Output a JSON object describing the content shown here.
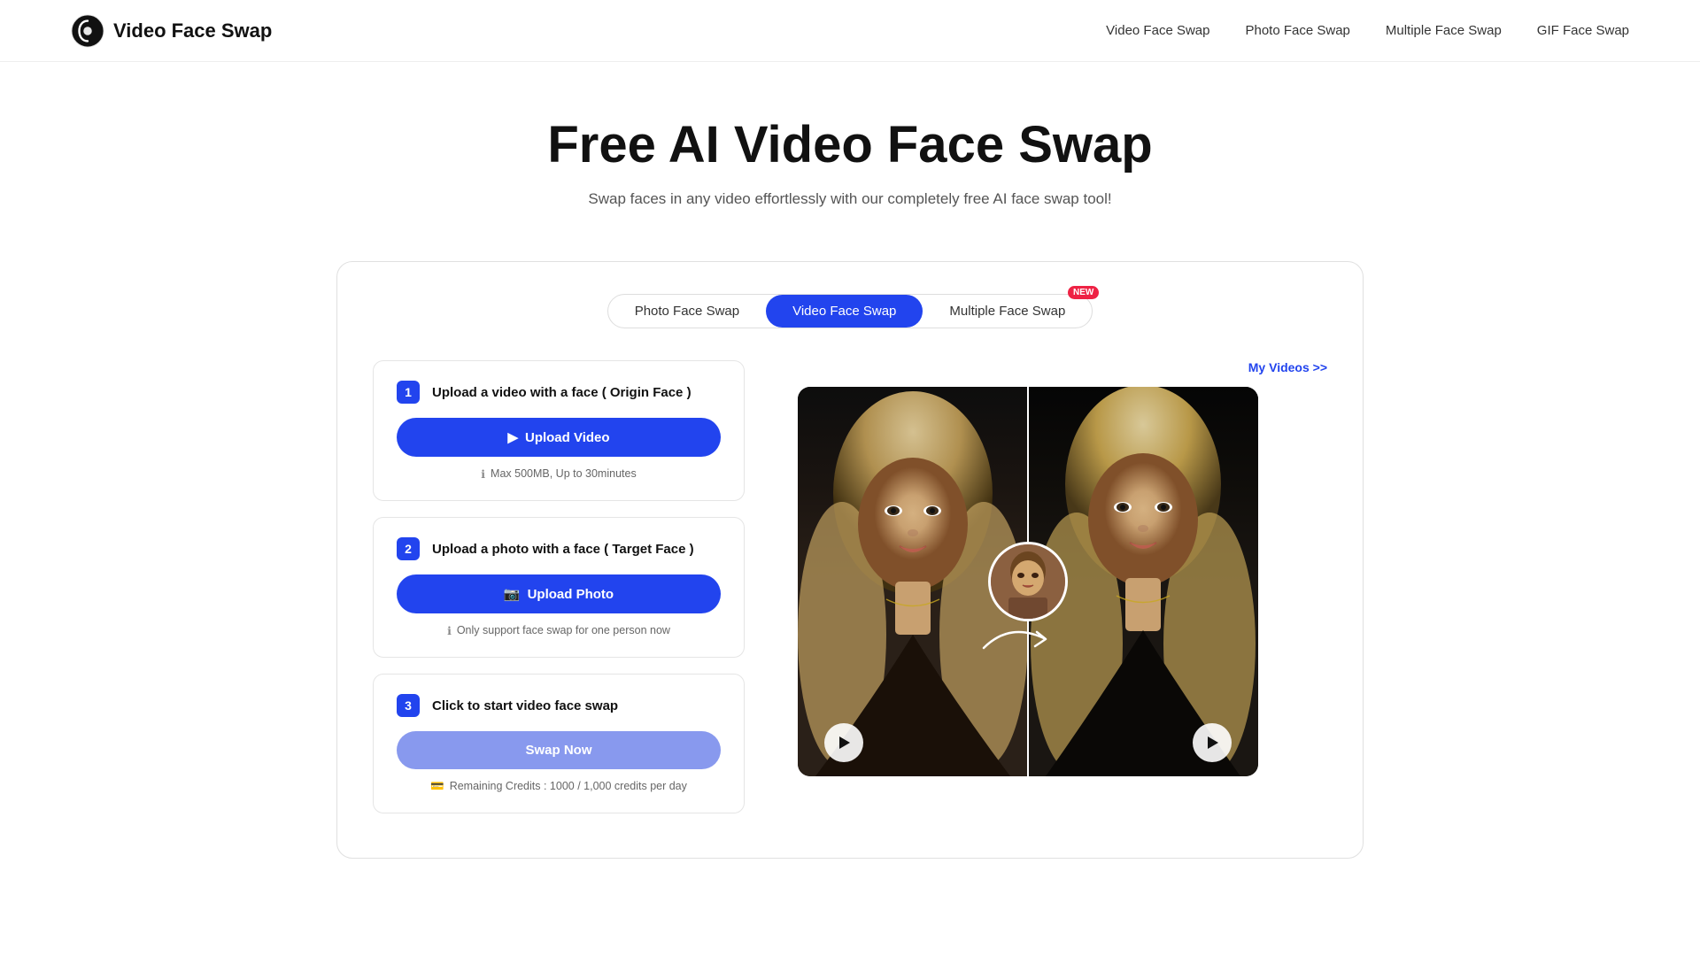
{
  "nav": {
    "logo_text": "Video Face Swap",
    "links": [
      {
        "label": "Video Face Swap",
        "id": "nav-video-face-swap"
      },
      {
        "label": "Photo Face Swap",
        "id": "nav-photo-face-swap"
      },
      {
        "label": "Multiple Face Swap",
        "id": "nav-multiple-face-swap"
      },
      {
        "label": "GIF Face Swap",
        "id": "nav-gif-face-swap"
      }
    ]
  },
  "hero": {
    "title": "Free AI Video Face Swap",
    "subtitle": "Swap faces in any video effortlessly with our completely free AI face swap tool!"
  },
  "tabs": [
    {
      "label": "Photo Face Swap",
      "active": false,
      "badge": null
    },
    {
      "label": "Video Face Swap",
      "active": true,
      "badge": null
    },
    {
      "label": "Multiple Face Swap",
      "active": false,
      "badge": "NEW"
    }
  ],
  "my_videos_link": "My Videos >>",
  "steps": [
    {
      "num": "1",
      "title": "Upload a video with a face ( Origin Face )",
      "button_label": "Upload Video",
      "note": "Max 500MB, Up to 30minutes",
      "note_type": "info"
    },
    {
      "num": "2",
      "title": "Upload a photo with a face ( Target Face )",
      "button_label": "Upload Photo",
      "note": "Only support face swap for one person now",
      "note_type": "info"
    },
    {
      "num": "3",
      "title": "Click to start video face swap",
      "button_label": "Swap Now",
      "note": "Remaining Credits : 1000 / 1,000 credits per day",
      "note_type": "credits",
      "disabled": true
    }
  ],
  "icons": {
    "play": "▶",
    "upload": "⬆",
    "image": "🖼",
    "info": "ℹ",
    "credits": "💳",
    "logo": "◑"
  }
}
